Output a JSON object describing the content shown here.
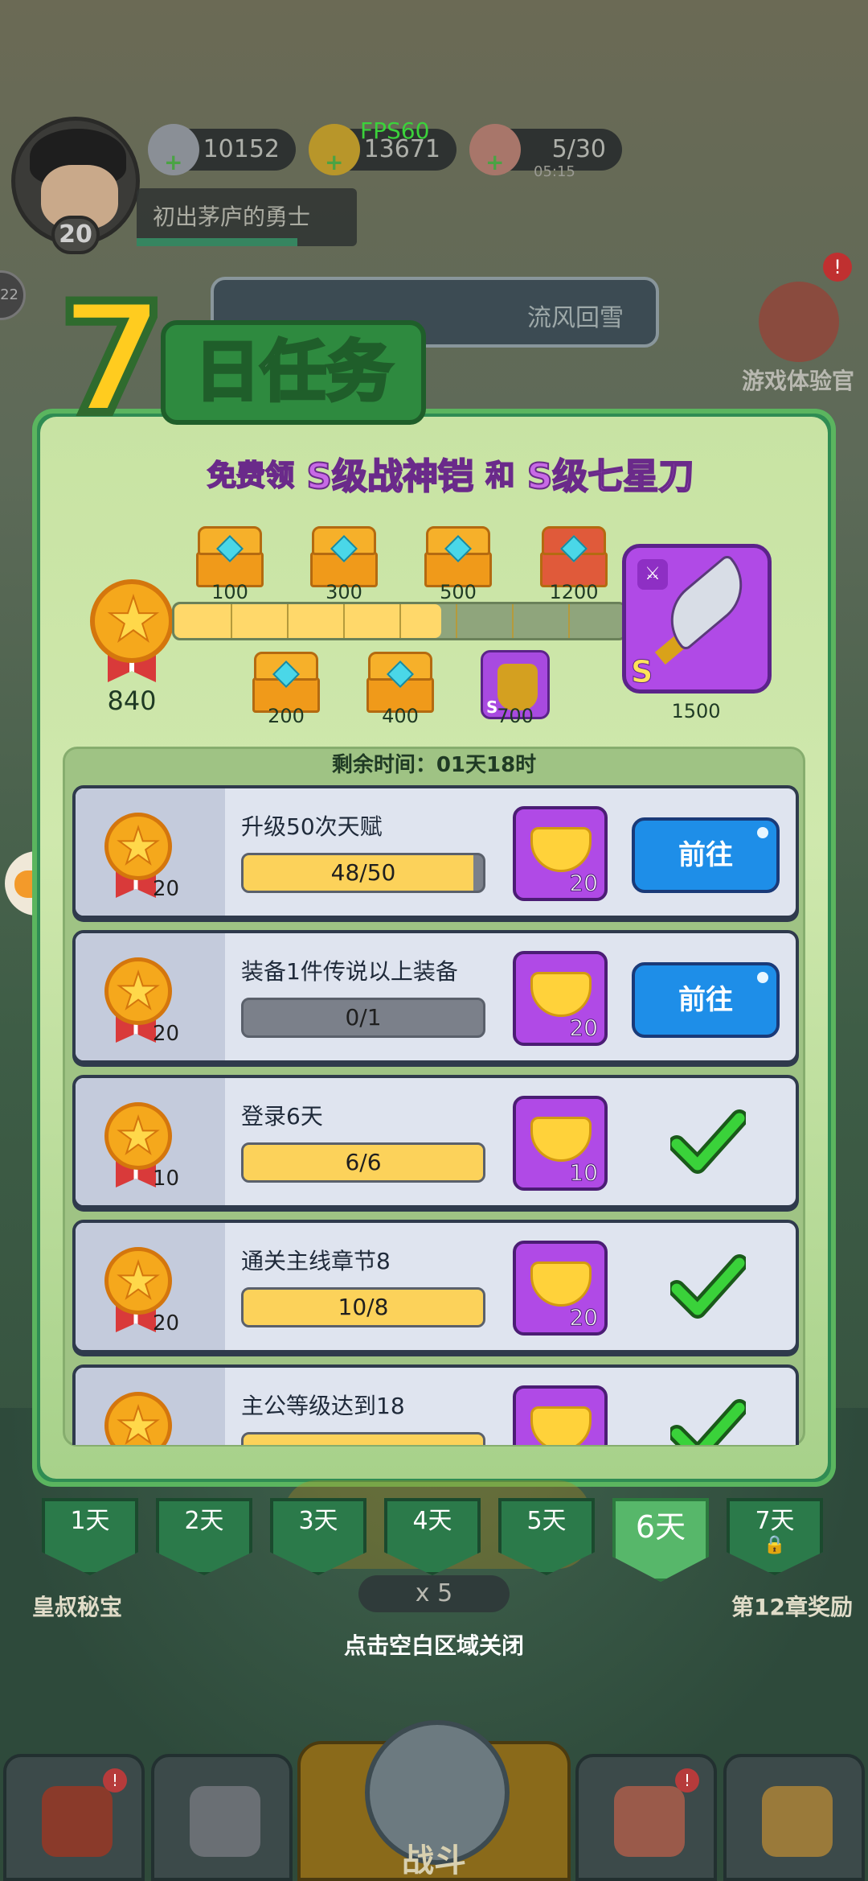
{
  "hud": {
    "player_level": "20",
    "player_title": "初出茅庐的勇士",
    "silver": "10152",
    "gold": "13671",
    "fps": "FPS60",
    "stamina": "5/30",
    "stamina_timer": "05:15",
    "side_badge": "22",
    "chapter_name": "流风回雪",
    "tester_label": "游戏体验官",
    "tester_badge": "!"
  },
  "header": {
    "seven": "7",
    "title": "日任务",
    "promo_free": "免费领",
    "promo_item1": "S级战神铠",
    "promo_and": "和",
    "promo_item2": "S级七星刀"
  },
  "progress": {
    "current": "840",
    "max": 1500,
    "value": 840,
    "milestones_top": [
      {
        "label": "100"
      },
      {
        "label": "300"
      },
      {
        "label": "500"
      },
      {
        "label": "1200"
      }
    ],
    "milestones_bottom": [
      {
        "label": "200"
      },
      {
        "label": "400"
      },
      {
        "label": "700"
      }
    ],
    "final_label": "1500",
    "armor_grade": "S",
    "blade_grade": "S"
  },
  "remaining": "剩余时间：01天18时",
  "tasks": [
    {
      "title": "升级50次天赋",
      "progress": "48/50",
      "ratio": 0.96,
      "points": "20",
      "reward": "20",
      "action": "前往",
      "done": false
    },
    {
      "title": "装备1件传说以上装备",
      "progress": "0/1",
      "ratio": 0,
      "points": "20",
      "reward": "20",
      "action": "前往",
      "done": false
    },
    {
      "title": "登录6天",
      "progress": "6/6",
      "ratio": 1,
      "points": "10",
      "reward": "10",
      "action": "",
      "done": true
    },
    {
      "title": "通关主线章节8",
      "progress": "10/8",
      "ratio": 1,
      "points": "20",
      "reward": "20",
      "action": "",
      "done": true
    },
    {
      "title": "主公等级达到18",
      "progress": "",
      "ratio": 1,
      "points": "",
      "reward": "",
      "action": "",
      "done": true
    }
  ],
  "days": [
    "1天",
    "2天",
    "3天",
    "4天",
    "5天",
    "6天",
    "7天"
  ],
  "active_day": 5,
  "close_hint": "点击空白区域关闭",
  "bottom": {
    "left_label": "皇叔秘宝",
    "right_label": "第12章奖励",
    "meat": "x 5",
    "battle": "战斗"
  },
  "colors": {
    "panel_green": "#2f8c53",
    "go_blue": "#1e8ee8",
    "reward_purple": "#b04ae6",
    "progress_yellow": "#fcd25a"
  }
}
